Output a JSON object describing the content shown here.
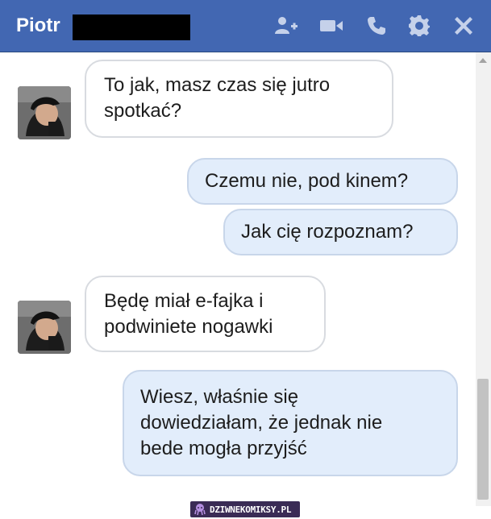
{
  "header": {
    "contact_name": "Piotr",
    "icons": [
      "add-person-icon",
      "video-camera-icon",
      "phone-icon",
      "gear-icon",
      "close-icon"
    ]
  },
  "colors": {
    "header_bg": "#4267b2",
    "outgoing_bubble": "#e2edfb",
    "incoming_bubble": "#ffffff"
  },
  "messages": [
    {
      "direction": "incoming",
      "text_lines": [
        "To jak, masz czas się jutro",
        "spotkać?"
      ]
    },
    {
      "direction": "outgoing",
      "text_lines": [
        "Czemu nie, pod kinem?"
      ]
    },
    {
      "direction": "outgoing",
      "text_lines": [
        "Jak cię rozpoznam?"
      ]
    },
    {
      "direction": "incoming",
      "text_lines": [
        "Będę miał e-fajka i",
        "podwiniete nogawki"
      ]
    },
    {
      "direction": "outgoing",
      "text_lines": [
        "Wiesz, właśnie się",
        "dowiedziałam, że jednak nie",
        "bede mogła przyjść"
      ]
    }
  ],
  "watermark": {
    "text": "DZIWNEKOMIKSY.PL"
  }
}
